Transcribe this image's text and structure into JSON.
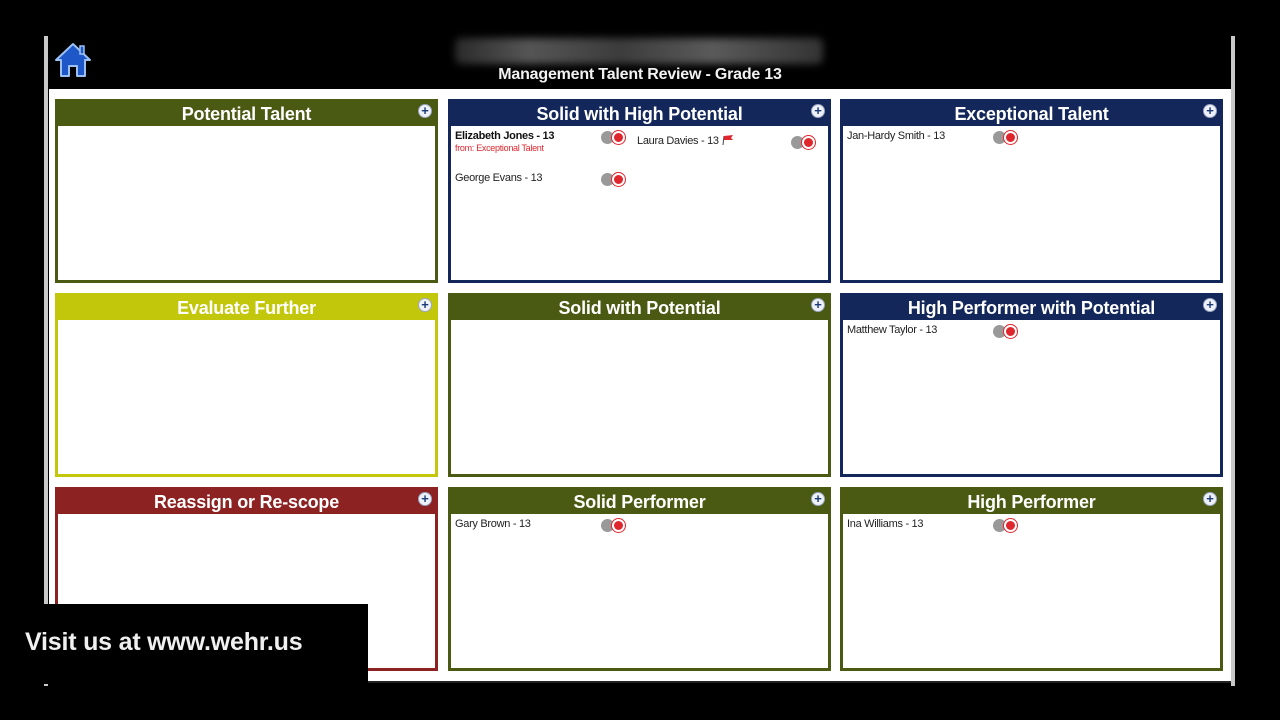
{
  "header": {
    "title": "Management Talent Review - Grade 13",
    "home_icon": "home-icon"
  },
  "colors": {
    "olive": "#4a5a12",
    "navy": "#13275a",
    "yellow_green": "#c3c70c",
    "maroon": "#8c2222",
    "alert_red": "#e0262d"
  },
  "grid": [
    {
      "title": "Potential Talent",
      "color": "#4a5a12",
      "employees": []
    },
    {
      "title": "Solid with High Potential",
      "color": "#13275a",
      "employees": [
        {
          "name": "Elizabeth Jones - 13",
          "note": "from: Exceptional Talent",
          "bold": true,
          "flag": false
        },
        {
          "name": "Laura Davies - 13",
          "note": "",
          "bold": false,
          "flag": true
        },
        {
          "name": "George Evans - 13",
          "note": "",
          "bold": false,
          "flag": false
        }
      ]
    },
    {
      "title": "Exceptional Talent",
      "color": "#13275a",
      "employees": [
        {
          "name": "Jan-Hardy Smith - 13",
          "note": "",
          "bold": false,
          "flag": false
        }
      ]
    },
    {
      "title": "Evaluate Further",
      "color": "#c3c70c",
      "employees": []
    },
    {
      "title": "Solid with Potential",
      "color": "#4a5a12",
      "employees": []
    },
    {
      "title": "High Performer with Potential",
      "color": "#13275a",
      "employees": [
        {
          "name": "Matthew Taylor - 13",
          "note": "",
          "bold": false,
          "flag": false
        }
      ]
    },
    {
      "title": "Reassign or Re-scope",
      "color": "#8c2222",
      "employees": []
    },
    {
      "title": "Solid Performer",
      "color": "#4a5a12",
      "employees": [
        {
          "name": "Gary Brown - 13",
          "note": "",
          "bold": false,
          "flag": false
        }
      ]
    },
    {
      "title": "High Performer",
      "color": "#4a5a12",
      "employees": [
        {
          "name": "Ina Williams - 13",
          "note": "",
          "bold": false,
          "flag": false
        }
      ]
    }
  ],
  "overlay": {
    "text": "Visit us at www.wehr.us"
  }
}
